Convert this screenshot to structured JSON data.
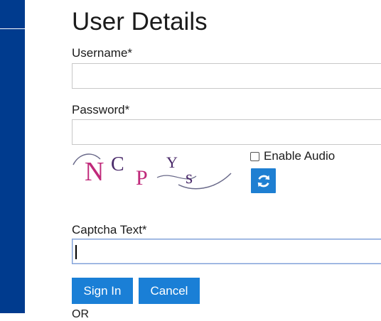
{
  "form": {
    "title": "User Details",
    "username_label": "Username*",
    "username_value": "",
    "password_label": "Password*",
    "password_value": "",
    "audio_label": "Enable Audio",
    "audio_checked": false,
    "captcha_label": "Captcha Text*",
    "captcha_value": "",
    "captcha_chars": [
      "N",
      "C",
      "P",
      "Y",
      "s"
    ],
    "signin_label": "Sign In",
    "cancel_label": "Cancel",
    "or_text": "OR"
  },
  "colors": {
    "sidebar": "#003b8e",
    "button": "#1a7fd6",
    "refresh_button": "#1e7fd2",
    "captcha_pink": "#c0297a",
    "captcha_purple": "#4a2a6a"
  },
  "icons": {
    "refresh": "refresh-icon",
    "checkbox": "checkbox-icon"
  }
}
